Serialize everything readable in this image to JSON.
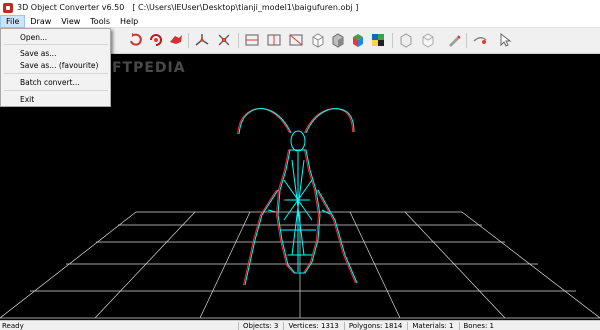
{
  "window": {
    "app_title": "3D Object Converter v6.50",
    "file_path": "[ C:\\Users\\IEUser\\Desktop\\tianji_model1\\baigufuren.obj ]"
  },
  "menubar": {
    "items": [
      "File",
      "Draw",
      "View",
      "Tools",
      "Help"
    ],
    "active": "File"
  },
  "file_menu": {
    "open": "Open...",
    "save_as": "Save as...",
    "save_as_favourite": "Save as... (favourite)",
    "batch_convert": "Batch convert...",
    "exit": "Exit"
  },
  "watermark": "SOFTPEDIA",
  "viewport": {
    "background": "#000000",
    "grid_color": "#ffffff",
    "model_colors": [
      "#ff2a2a",
      "#00ffff"
    ]
  },
  "toolbar": {
    "icons": [
      "rotate-icon",
      "rotate-alt-icon",
      "model-red-icon",
      "axis-icon",
      "axis-x-icon",
      "bounding-box-icon",
      "bounding-box-alt-icon",
      "bounding-box-3-icon",
      "cube-white-icon",
      "cube-gray-icon",
      "cube-color-icon",
      "cube-texture-icon",
      "cube-outline-icon",
      "cube-outline-alt-icon",
      "edit-icon",
      "camera-icon",
      "pointer-icon"
    ]
  },
  "status": {
    "ready": "Ready",
    "objects": "Objects: 3",
    "vertices": "Vertices: 1313",
    "polygons": "Polygons: 1814",
    "materials": "Materials: 1",
    "bones": "Bones: 1"
  }
}
